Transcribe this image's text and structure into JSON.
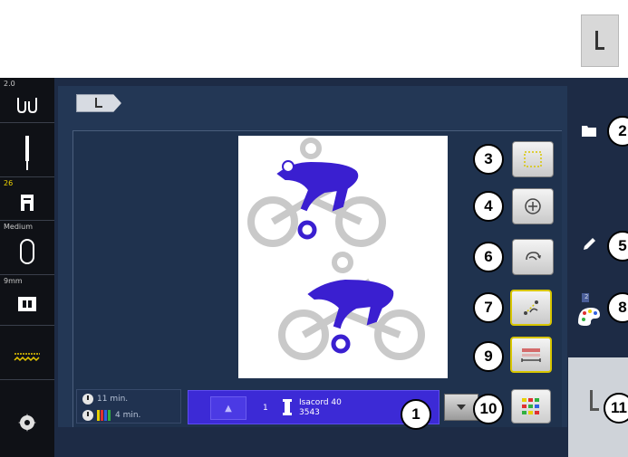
{
  "left_status": {
    "stitch_width_label": "2.0",
    "presser_foot_label": "26",
    "tension_label": "Medium",
    "height_label": "9mm"
  },
  "tab": {
    "icon": "presser-foot-icon"
  },
  "tool_buttons": [
    {
      "number": "3",
      "icon": "select-frame-icon"
    },
    {
      "number": "4",
      "icon": "center-target-icon"
    },
    {
      "number": "6",
      "icon": "rotate-needle-icon"
    },
    {
      "number": "7",
      "icon": "split-stitch-icon"
    },
    {
      "number": "9",
      "icon": "color-sequence-icon"
    }
  ],
  "badges": {
    "b1": "1",
    "b2": "2",
    "b3": "3",
    "b4": "4",
    "b5": "5",
    "b6": "6",
    "b7": "7",
    "b8": "8",
    "b9": "9",
    "b10": "10",
    "b11": "11"
  },
  "time": {
    "total": "11 min.",
    "color": "4 min."
  },
  "color_bar": {
    "index": "1",
    "thread_name": "Isacord 40",
    "thread_number": "3543",
    "up_arrow": "▲"
  },
  "sidebar": {
    "page_number": "2"
  },
  "colors": {
    "screen_bg": "#1d2b45",
    "thread_blue": "#3c2ad6",
    "motif_blue": "#3a1fd0",
    "motif_grey": "#c9c9c9",
    "highlight_yellow": "#d8c600"
  }
}
